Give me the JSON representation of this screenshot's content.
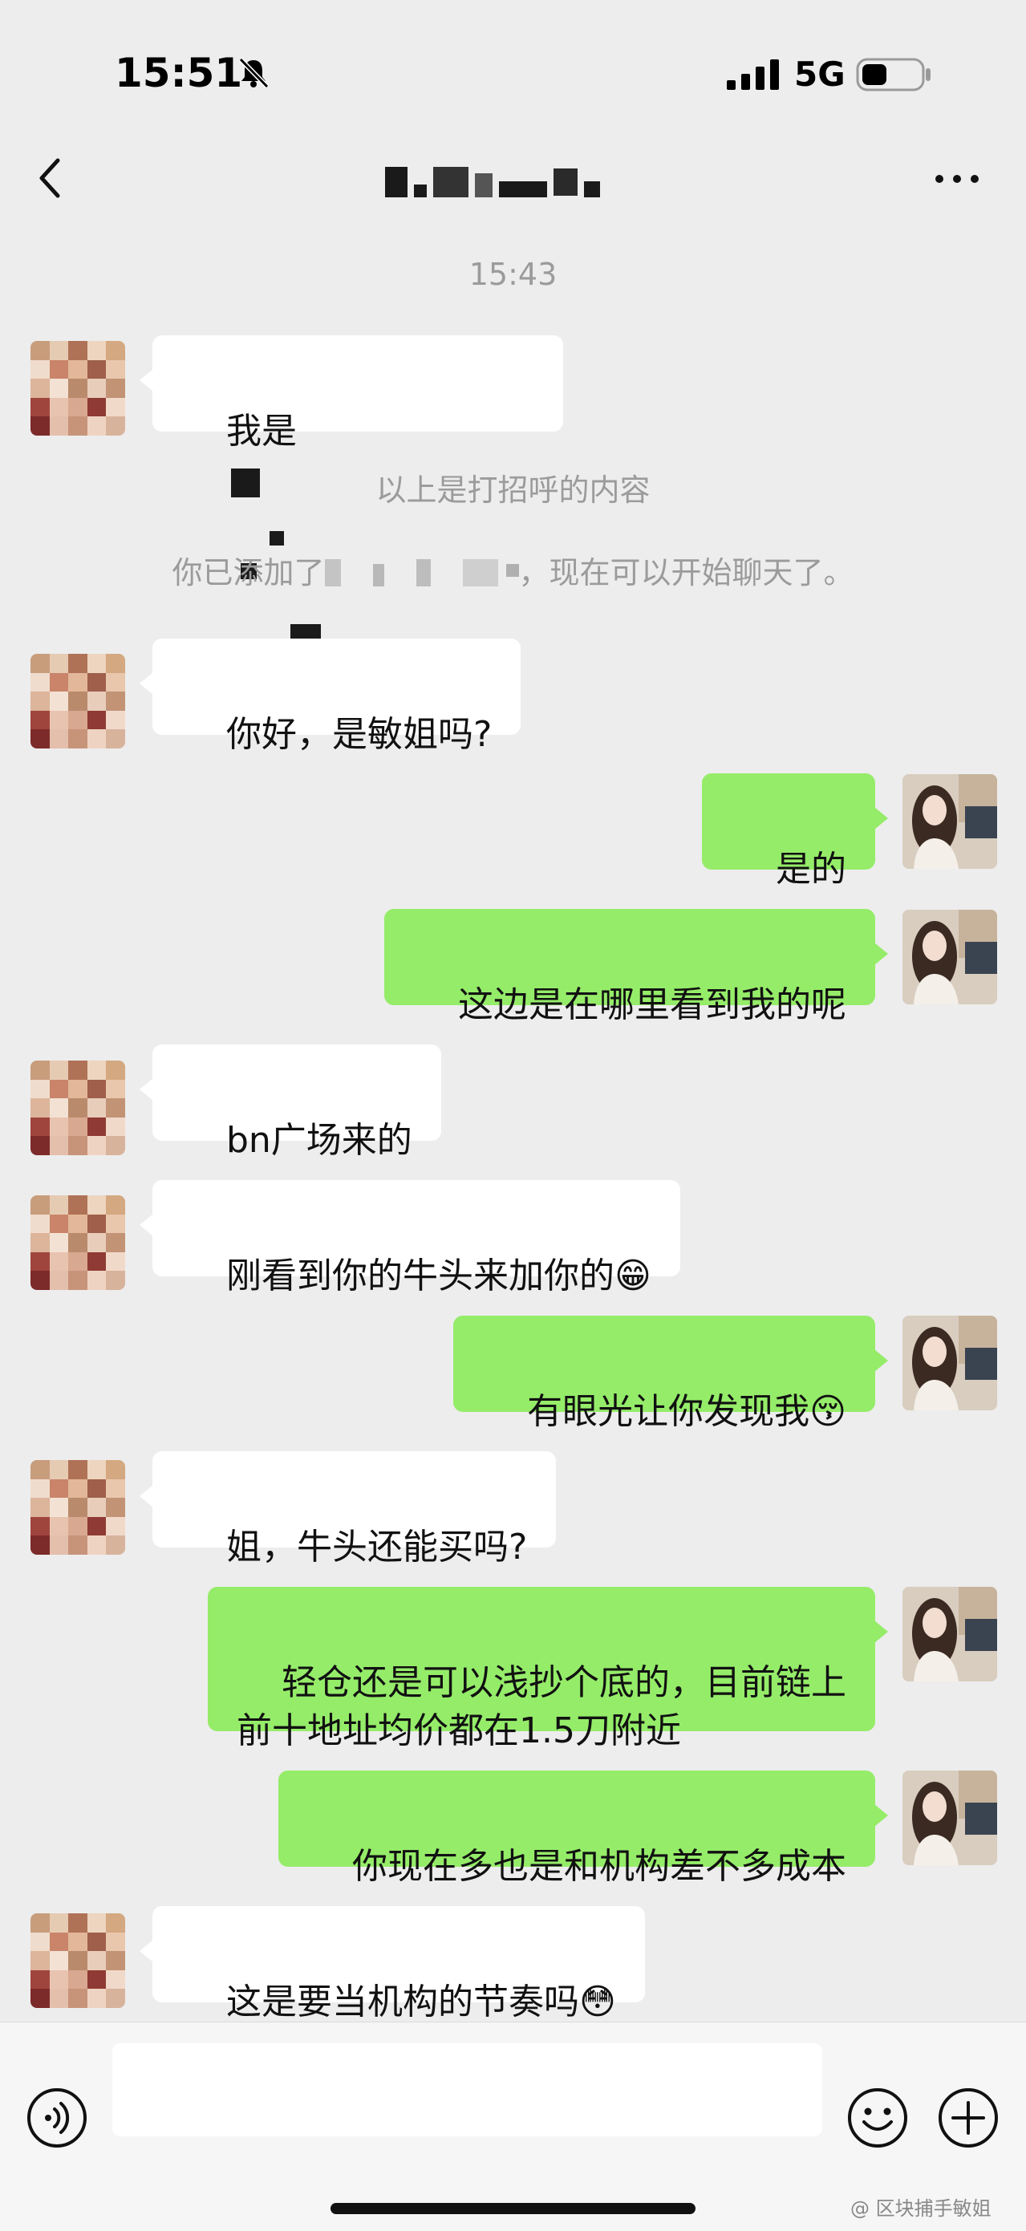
{
  "status_bar": {
    "time": "15:51",
    "network": "5G",
    "icons": [
      "bell-muted-icon",
      "signal-icon",
      "battery-icon"
    ]
  },
  "nav": {
    "title": "",
    "back_icon": "chevron-left-icon",
    "more_icon": "more-dots-icon"
  },
  "chat": {
    "timestamp": "15:43",
    "greeting_partial": "我是",
    "greeting_note": "以上是打招呼的内容",
    "added_prefix": "你已添加了",
    "added_suffix": "，现在可以开始聊天了。",
    "messages": [
      {
        "side": "in",
        "text": "你好，是敏姐吗?"
      },
      {
        "side": "out",
        "text": "是的"
      },
      {
        "side": "out",
        "text": "这边是在哪里看到我的呢"
      },
      {
        "side": "in",
        "text": "bn广场来的"
      },
      {
        "side": "in",
        "text": "刚看到你的牛头来加你的😁"
      },
      {
        "side": "out",
        "text": "有眼光让你发现我😚"
      },
      {
        "side": "in",
        "text": "姐，牛头还能买吗?"
      },
      {
        "side": "out",
        "text": "轻仓还是可以浅抄个底的，目前链上\n前十地址均价都在1.5刀附近"
      },
      {
        "side": "out",
        "text": "你现在多也是和机构差不多成本"
      },
      {
        "side": "in",
        "text": "这是要当机构的节奏吗😳"
      }
    ]
  },
  "input_bar": {
    "placeholder": "",
    "icons": [
      "voice-icon",
      "emoji-icon",
      "plus-icon"
    ]
  },
  "watermark": "@ 区块捕手敏姐",
  "colors": {
    "background": "#ededed",
    "bubble_out": "#95ec69",
    "bubble_in": "#ffffff",
    "system_text": "#9b9b9b"
  }
}
